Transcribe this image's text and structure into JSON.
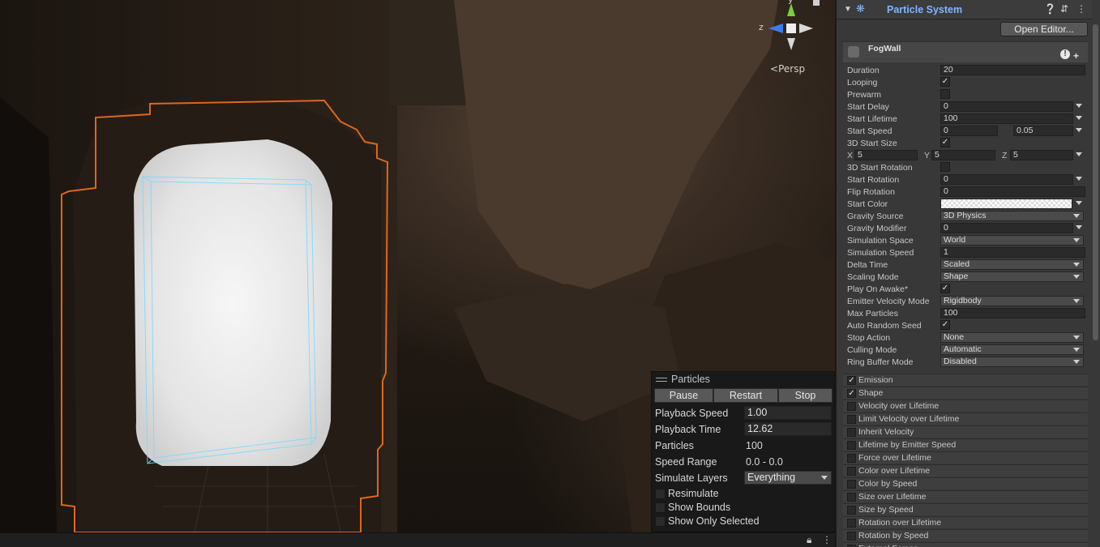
{
  "scene": {
    "persp_label": "Persp",
    "gizmo_axis_z": "z",
    "gizmo_axis_y": "y"
  },
  "particles_panel": {
    "title": "Particles",
    "buttons": [
      "Pause",
      "Restart",
      "Stop"
    ],
    "playback_speed_label": "Playback Speed",
    "playback_speed": "1.00",
    "playback_time_label": "Playback Time",
    "playback_time": "12.62",
    "particles_label": "Particles",
    "particles": "100",
    "speed_range_label": "Speed Range",
    "speed_range": "0.0 - 0.0",
    "simulate_layers_label": "Simulate Layers",
    "simulate_layers": "Everything",
    "resimulate": "Resimulate",
    "show_bounds": "Show Bounds",
    "show_only_selected": "Show Only Selected"
  },
  "inspector": {
    "component_title": "Particle System",
    "open_editor": "Open Editor...",
    "system_name": "FogWall",
    "warn_glyph": "!",
    "plus_glyph": "+",
    "fields": [
      {
        "label": "Duration",
        "kind": "field",
        "value": "20"
      },
      {
        "label": "Looping",
        "kind": "check",
        "checked": true
      },
      {
        "label": "Prewarm",
        "kind": "check",
        "checked": false
      },
      {
        "label": "Start Delay",
        "kind": "field-mm",
        "value": "0"
      },
      {
        "label": "Start Lifetime",
        "kind": "field-mm",
        "value": "100"
      },
      {
        "label": "Start Speed",
        "kind": "two-mm",
        "value": "0",
        "value2": "0.05"
      },
      {
        "label": "3D Start Size",
        "kind": "check",
        "checked": true
      },
      {
        "label": "",
        "kind": "xyz",
        "x": "5",
        "y": "5",
        "z": "5"
      },
      {
        "label": "3D Start Rotation",
        "kind": "check",
        "checked": false
      },
      {
        "label": "Start Rotation",
        "kind": "field-mm",
        "value": "0"
      },
      {
        "label": "Flip Rotation",
        "kind": "field",
        "value": "0"
      },
      {
        "label": "Start Color",
        "kind": "color"
      },
      {
        "label": "Gravity Source",
        "kind": "select",
        "value": "3D Physics"
      },
      {
        "label": "Gravity Modifier",
        "kind": "field-mm",
        "value": "0"
      },
      {
        "label": "Simulation Space",
        "kind": "select",
        "value": "World"
      },
      {
        "label": "Simulation Speed",
        "kind": "field",
        "value": "1"
      },
      {
        "label": "Delta Time",
        "kind": "select",
        "value": "Scaled"
      },
      {
        "label": "Scaling Mode",
        "kind": "select",
        "value": "Shape"
      },
      {
        "label": "Play On Awake*",
        "kind": "check",
        "checked": true
      },
      {
        "label": "Emitter Velocity Mode",
        "kind": "select",
        "value": "Rigidbody"
      },
      {
        "label": "Max Particles",
        "kind": "field",
        "value": "100"
      },
      {
        "label": "Auto Random Seed",
        "kind": "check",
        "checked": true
      },
      {
        "label": "Stop Action",
        "kind": "select",
        "value": "None"
      },
      {
        "label": "Culling Mode",
        "kind": "select",
        "value": "Automatic"
      },
      {
        "label": "Ring Buffer Mode",
        "kind": "select",
        "value": "Disabled"
      }
    ],
    "modules": [
      {
        "label": "Emission",
        "checked": true
      },
      {
        "label": "Shape",
        "checked": true
      },
      {
        "label": "Velocity over Lifetime",
        "checked": false
      },
      {
        "label": "Limit Velocity over Lifetime",
        "checked": false
      },
      {
        "label": "Inherit Velocity",
        "checked": false
      },
      {
        "label": "Lifetime by Emitter Speed",
        "checked": false
      },
      {
        "label": "Force over Lifetime",
        "checked": false
      },
      {
        "label": "Color over Lifetime",
        "checked": false
      },
      {
        "label": "Color by Speed",
        "checked": false
      },
      {
        "label": "Size over Lifetime",
        "checked": false
      },
      {
        "label": "Size by Speed",
        "checked": false
      },
      {
        "label": "Rotation over Lifetime",
        "checked": false
      },
      {
        "label": "Rotation by Speed",
        "checked": false
      },
      {
        "label": "External Forces",
        "checked": false
      }
    ]
  },
  "colors": {
    "title_blue": "#7fb6ff",
    "selection_orange": "#e0661a",
    "bounds_cyan": "#7fd8ff"
  }
}
